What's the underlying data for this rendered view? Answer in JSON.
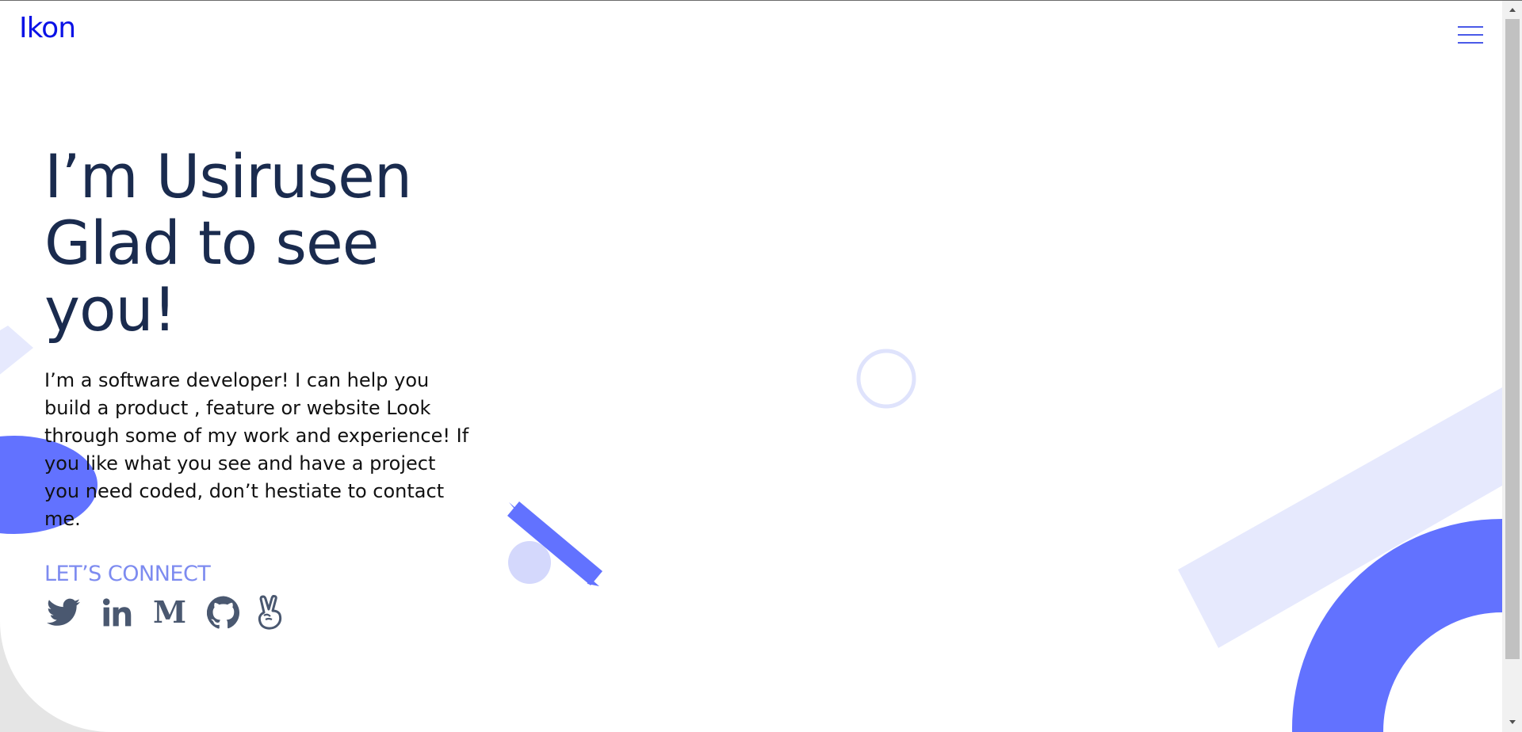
{
  "header": {
    "logo": "Ikon",
    "menu_icon": "hamburger-menu-icon"
  },
  "hero": {
    "title_lines": [
      "I’m Usirusen",
      "Glad to see",
      "you!"
    ],
    "description": "I’m a software developer! I can help you build a product , feature or website Look through some of my work and experience! If you like what you see and have a project you need coded, don’t hestiate to contact me."
  },
  "connect": {
    "label": "LET’S CONNECT",
    "links": [
      {
        "name": "twitter",
        "icon": "twitter-icon"
      },
      {
        "name": "linkedin",
        "icon": "linkedin-icon"
      },
      {
        "name": "medium",
        "icon": "medium-icon"
      },
      {
        "name": "github",
        "icon": "github-icon"
      },
      {
        "name": "angellist",
        "icon": "angellist-icon"
      }
    ]
  },
  "colors": {
    "brand": "#0a12e6",
    "title": "#1a2b4e",
    "accent": "#6272ff",
    "accent_light": "#e6e9fd",
    "connect_label": "#7d8bf0",
    "icon": "#4a5870"
  }
}
